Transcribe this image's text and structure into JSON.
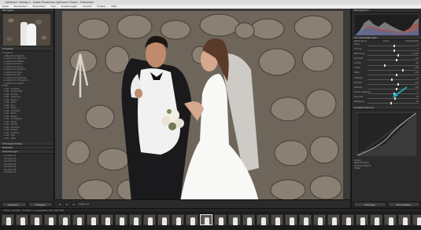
{
  "app": {
    "title": "Lightroom Catalog-2 - Adobe Photoshop Lightroom Classic - Entwickeln"
  },
  "menu": [
    "Datei",
    "Bearbeiten",
    "Entwickeln",
    "Foto",
    "Einstellungen",
    "Ansicht",
    "Fenster",
    "Hilfe"
  ],
  "left_panel": {
    "navigator_title": "Navigator",
    "presets_title": "Vorgaben",
    "folders": [
      {
        "label": "Vorgaben",
        "sub": false
      },
      {
        "label": "Benutzervorgaben",
        "sub": true
      },
      {
        "label": "Lightroom-Allgemein",
        "sub": true
      },
      {
        "label": "Lightroom-Effekte",
        "sub": true
      },
      {
        "label": "Lightroom-Farbe",
        "sub": true
      },
      {
        "label": "Lightroom-Kurve",
        "sub": true
      },
      {
        "label": "Lightroom-Schärfen",
        "sub": true
      },
      {
        "label": "Lightroom-Video",
        "sub": true
      },
      {
        "label": "Lightroom-S/W",
        "sub": true
      },
      {
        "label": "Lightroom-S/W-Filter",
        "sub": true
      },
      {
        "label": "Lightroom-S/W-getönt",
        "sub": true
      },
      {
        "label": "Lightroom-Getönt",
        "sub": true
      },
      {
        "label": "Stile",
        "sub": false
      },
      {
        "label": "Stil - Kontrast",
        "sub": true
      },
      {
        "label": "Stil - Landschaft",
        "sub": true
      },
      {
        "label": "Stil - Porträt",
        "sub": true
      },
      {
        "label": "Stil - Lebendig",
        "sub": true
      },
      {
        "label": "Stil - Modern",
        "sub": true
      },
      {
        "label": "Stil - Retro",
        "sub": true
      },
      {
        "label": "Stil - Kino",
        "sub": true
      },
      {
        "label": "Stil - Reise",
        "sub": true
      },
      {
        "label": "Stil - Hochzeit",
        "sub": true
      },
      {
        "label": "Stil - Mode",
        "sub": true
      },
      {
        "label": "Stil - Essen",
        "sub": true
      },
      {
        "label": "Stil - Architektur",
        "sub": true
      },
      {
        "label": "Stil - Nacht",
        "sub": true
      },
      {
        "label": "Stil - Winter",
        "sub": true
      },
      {
        "label": "Stil - Sommer",
        "sub": true
      },
      {
        "label": "Stil - Herbst",
        "sub": true
      },
      {
        "label": "Stil - Frühling",
        "sub": true
      },
      {
        "label": "Stil - S/W",
        "sub": true
      },
      {
        "label": "Stil - Matt",
        "sub": true
      }
    ],
    "sections": [
      "Schnappschüsse",
      "Protokoll",
      "Sammlungen"
    ],
    "collections": [
      "Hochzeit 01",
      "Hochzeit 02",
      "Hochzeit 03",
      "Hochzeit 04",
      "Hochzeit 05",
      "Hochzeit 06",
      "Hochzeit 07"
    ],
    "copy_button": "Kopieren...",
    "paste_button": "Einfügen"
  },
  "right_panel": {
    "histogram_title": "Histogramm",
    "basic_title": "Grundeinstellungen",
    "treatment": "Behandlung:",
    "color": "Farbe",
    "bw": "Schwarzweiß",
    "sliders": [
      {
        "label": "Temp",
        "value": "0",
        "pos": 0.5
      },
      {
        "label": "Tönung",
        "value": "0",
        "pos": 0.5
      },
      {
        "label": "Belichtung",
        "value": "+0,35",
        "pos": 0.58
      },
      {
        "label": "Kontrast",
        "value": "+10",
        "pos": 0.55
      },
      {
        "label": "Lichter",
        "value": "-45",
        "pos": 0.33
      },
      {
        "label": "Tiefen",
        "value": "+38",
        "pos": 0.68
      },
      {
        "label": "Weiß",
        "value": "+12",
        "pos": 0.56
      },
      {
        "label": "Schwarz",
        "value": "-8",
        "pos": 0.46
      },
      {
        "label": "Struktur",
        "value": "+15",
        "pos": 0.58
      },
      {
        "label": "Klarheit",
        "value": "+10",
        "pos": 0.55
      },
      {
        "label": "Dunst entfernen",
        "value": "0",
        "pos": 0.5
      },
      {
        "label": "Dynamik",
        "value": "+5",
        "pos": 0.52
      },
      {
        "label": "Sättigung",
        "value": "-10",
        "pos": 0.45
      }
    ],
    "curve_title": "Gradationskurve",
    "curve_sliders": [
      "Lichter",
      "Helle Farbtöne",
      "Dunkle Farbtöne",
      "Tiefen"
    ],
    "prev_button": "Vorherige",
    "reset_button": "Zurücksetzen"
  },
  "toolbar": {
    "label": "Softproof"
  },
  "filmstrip": {
    "info": "Ordner: Hochzeit · 34 Fotos / 1 ausgewählt / DSC_0412.NEF",
    "frame_count": 31,
    "selected_index": 14
  },
  "colors": {
    "accent_arrow": "#19b8d0",
    "panel_bg": "#2b2b2b"
  }
}
